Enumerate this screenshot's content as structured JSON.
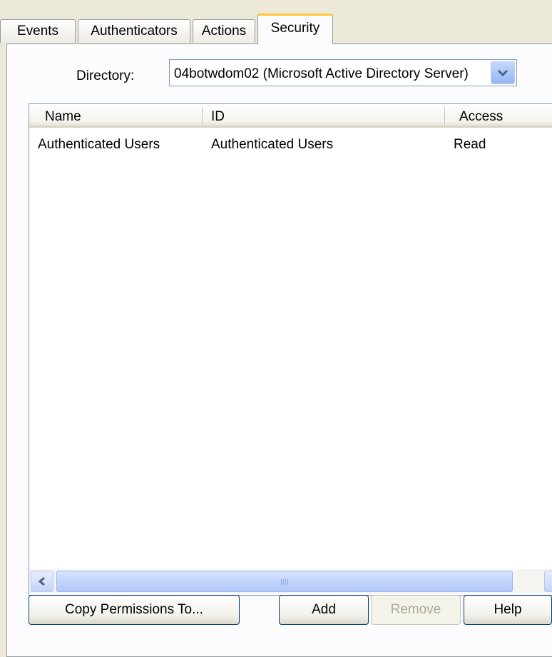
{
  "tabs": [
    {
      "label": "Events"
    },
    {
      "label": "Authenticators"
    },
    {
      "label": "Actions"
    },
    {
      "label": "Security"
    }
  ],
  "selected_tab": "Security",
  "directory": {
    "label": "Directory:",
    "value": "04botwdom02 (Microsoft Active Directory Server)"
  },
  "list": {
    "columns": [
      {
        "label": "Name"
      },
      {
        "label": "ID"
      },
      {
        "label": "Access"
      }
    ],
    "rows": [
      {
        "name": "Authenticated Users",
        "id": "Authenticated Users",
        "access": "Read"
      }
    ]
  },
  "buttons": {
    "copy_permissions": "Copy Permissions To...",
    "add": "Add",
    "remove": "Remove",
    "help": "Help"
  },
  "colors": {
    "window_bg": "#ECE9D8",
    "selected_tab_accent": "#FFC83C",
    "scroll_accent": "#C2D4FC"
  },
  "icons": {
    "combo_arrow": "chevron-down-icon",
    "scroll_left": "arrow-left-icon",
    "scroll_right": "arrow-right-icon"
  }
}
